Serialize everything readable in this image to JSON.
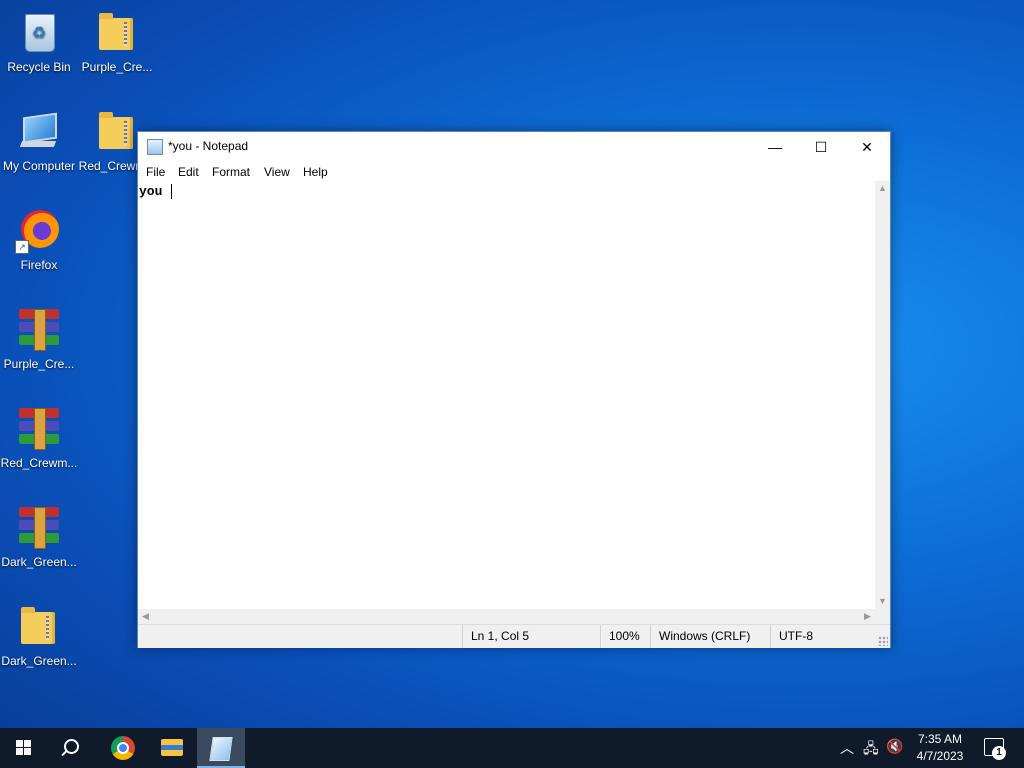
{
  "desktop": {
    "icons": [
      {
        "label": "Recycle Bin"
      },
      {
        "label": "Purple_Cre..."
      },
      {
        "label": "My Computer"
      },
      {
        "label": "Red_Crewm..."
      },
      {
        "label": "Firefox"
      },
      {
        "label": "Purple_Cre..."
      },
      {
        "label": "Red_Crewm..."
      },
      {
        "label": "Dark_Green..."
      },
      {
        "label": "Dark_Green..."
      }
    ]
  },
  "notepad": {
    "title": "*you - Notepad",
    "window_buttons": {
      "minimize": "—",
      "maximize": "☐",
      "close": "✕"
    },
    "menu": [
      "File",
      "Edit",
      "Format",
      "View",
      "Help"
    ],
    "content": "you ",
    "status": {
      "position": "Ln 1, Col 5",
      "zoom": "100%",
      "line_ending": "Windows (CRLF)",
      "encoding": "UTF-8"
    }
  },
  "taskbar": {
    "apps": [
      "start",
      "search",
      "chrome",
      "file-explorer",
      "notepad"
    ],
    "active_app": "notepad",
    "tray": {
      "time": "7:35 AM",
      "date": "4/7/2023",
      "notification_count": "1"
    }
  }
}
